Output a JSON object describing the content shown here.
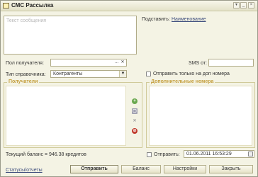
{
  "window": {
    "title": "СМС Рассылка"
  },
  "message": {
    "placeholder": "Текст сообщения"
  },
  "substitute": {
    "label": "Подставить:",
    "link": "Наименование"
  },
  "recipient_field": {
    "label": "Пол получателя:",
    "value": "",
    "button": "..."
  },
  "sms_from": {
    "label": "SMS от:",
    "value": ""
  },
  "ref_type": {
    "label": "Тип справочника:",
    "value": "Контрагенты"
  },
  "send_only_extra": {
    "label": "Отправить только на доп номера"
  },
  "recipients_group": {
    "title": "Получатели"
  },
  "extra_numbers_group": {
    "title": "Дополнительные номера"
  },
  "balance": {
    "text": "Текущий баланс = 946.38 кредитов"
  },
  "send_at": {
    "label": "Отправить:",
    "value": "01.06.2011 16:53:29"
  },
  "links": {
    "status": "Статусы/отчеты"
  },
  "buttons": {
    "send": "Отправить",
    "balance": "Баланс",
    "settings": "Настройки",
    "close": "Закрыть"
  },
  "side_icons": [
    "add-icon",
    "copy-icon",
    "delete-icon",
    "stop-icon"
  ],
  "colors": {
    "group_title": "#c5a040",
    "link": "#3c4c7c"
  }
}
